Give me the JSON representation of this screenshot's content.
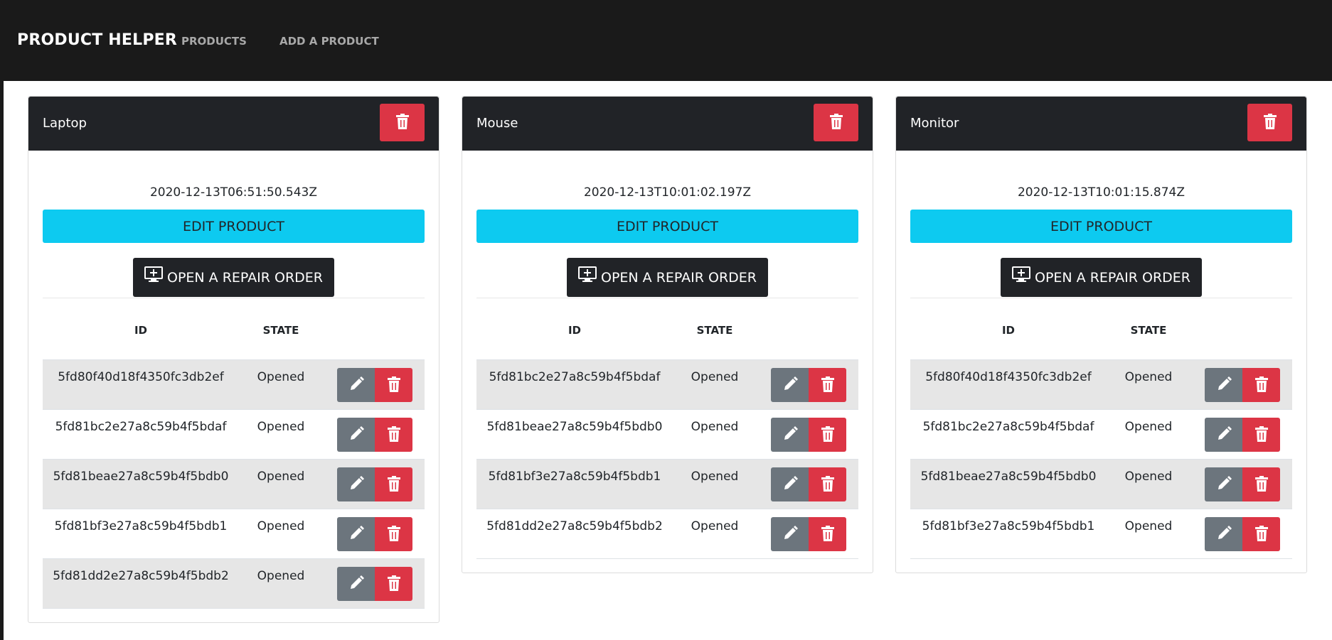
{
  "nav": {
    "brand": "PRODUCT HELPER",
    "products": "PRODUCTS",
    "add_product": "ADD A PRODUCT"
  },
  "colors": {
    "navbar": "#1a1a1a",
    "card_header": "#212327",
    "danger": "#dc3545",
    "info": "#0dcaf0",
    "secondary": "#6c757d",
    "stripe": "#e6e6e6"
  },
  "labels": {
    "edit_product": "EDIT PRODUCT",
    "open_repair_order": "OPEN A REPAIR ORDER",
    "col_id": "ID",
    "col_state": "STATE"
  },
  "icons": {
    "delete": "trash-icon",
    "edit": "pencil-icon",
    "repair": "monitor-plus-icon"
  },
  "products": [
    {
      "name": "Laptop",
      "date": "2020-12-13T06:51:50.543Z",
      "orders": [
        {
          "id": "5fd80f40d18f4350fc3db2ef",
          "state": "Opened"
        },
        {
          "id": "5fd81bc2e27a8c59b4f5bdaf",
          "state": "Opened"
        },
        {
          "id": "5fd81beae27a8c59b4f5bdb0",
          "state": "Opened"
        },
        {
          "id": "5fd81bf3e27a8c59b4f5bdb1",
          "state": "Opened"
        },
        {
          "id": "5fd81dd2e27a8c59b4f5bdb2",
          "state": "Opened"
        }
      ]
    },
    {
      "name": "Mouse",
      "date": "2020-12-13T10:01:02.197Z",
      "orders": [
        {
          "id": "5fd81bc2e27a8c59b4f5bdaf",
          "state": "Opened"
        },
        {
          "id": "5fd81beae27a8c59b4f5bdb0",
          "state": "Opened"
        },
        {
          "id": "5fd81bf3e27a8c59b4f5bdb1",
          "state": "Opened"
        },
        {
          "id": "5fd81dd2e27a8c59b4f5bdb2",
          "state": "Opened"
        }
      ]
    },
    {
      "name": "Monitor",
      "date": "2020-12-13T10:01:15.874Z",
      "orders": [
        {
          "id": "5fd80f40d18f4350fc3db2ef",
          "state": "Opened"
        },
        {
          "id": "5fd81bc2e27a8c59b4f5bdaf",
          "state": "Opened"
        },
        {
          "id": "5fd81beae27a8c59b4f5bdb0",
          "state": "Opened"
        },
        {
          "id": "5fd81bf3e27a8c59b4f5bdb1",
          "state": "Opened"
        }
      ]
    }
  ]
}
